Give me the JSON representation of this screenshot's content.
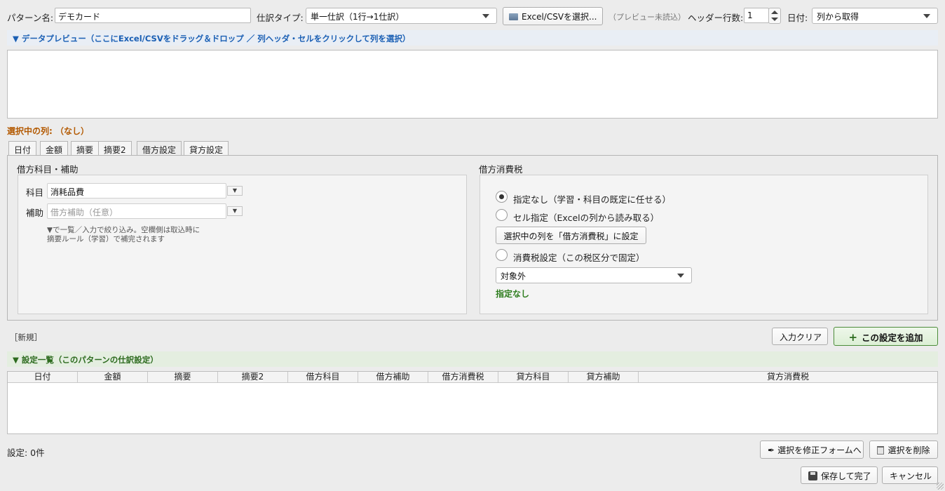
{
  "top": {
    "pattern_label": "パターン名:",
    "pattern_value": "デモカード",
    "type_label": "仕訳タイプ:",
    "type_value": "単一仕訳（1行→1仕訳）",
    "select_file_button": "Excel/CSVを選択...",
    "preview_status": "（プレビュー未読込）",
    "header_rows_label": "ヘッダー行数:",
    "header_rows_value": "1",
    "date_label": "日付:",
    "date_value": "列から取得"
  },
  "preview": {
    "title": "▼ データプレビュー（ここにExcel/CSVをドラッグ＆ドロップ ／ 列ヘッダ・セルをクリックして列を選択）"
  },
  "selected_column": "選択中の列: （なし）",
  "tabs": [
    {
      "label": "日付"
    },
    {
      "label": "金額"
    },
    {
      "label": "摘要"
    },
    {
      "label": "摘要2"
    },
    {
      "label": "借方設定"
    },
    {
      "label": "貸方設定"
    }
  ],
  "debit_account": {
    "title": "借方科目・補助",
    "account_label": "科目",
    "account_value": "消耗品費",
    "sub_label": "補助",
    "sub_placeholder": "借方補助（任意）",
    "hint_line1": "▼で一覧／入力で絞り込み。空欄側は取込時に",
    "hint_line2": "摘要ルール（学習）で補完されます",
    "dropdown_glyph": "▼"
  },
  "debit_tax": {
    "title": "借方消費税",
    "option_none": "指定なし（学習・科目の既定に任せる）",
    "option_cell": "セル指定（Excelの列から読み取る）",
    "set_column_button": "選択中の列を「借方消費税」に設定",
    "option_fixed": "消費税設定（この税区分で固定）",
    "tax_value": "対象外",
    "status": "指定なし"
  },
  "mode_label": "［新規］",
  "clear_button": "入力クリア",
  "add_button": "この設定を追加",
  "settings": {
    "title": "▼ 設定一覧（このパターンの仕訳設定）",
    "columns": [
      "日付",
      "金額",
      "摘要",
      "摘要2",
      "借方科目",
      "借方補助",
      "借方消費税",
      "貸方科目",
      "貸方補助",
      "貸方消費税"
    ]
  },
  "count_label": "設定: 0件",
  "edit_button": "選択を修正フォームへ",
  "delete_button": "選択を削除",
  "save_button": "保存して完了",
  "cancel_button": "キャンセル",
  "colors": {
    "preview_title": "#1a5fb4",
    "selected_column": "#b35900",
    "status_green": "#2e7d1e",
    "add_button_border": "#4c8c3a"
  }
}
